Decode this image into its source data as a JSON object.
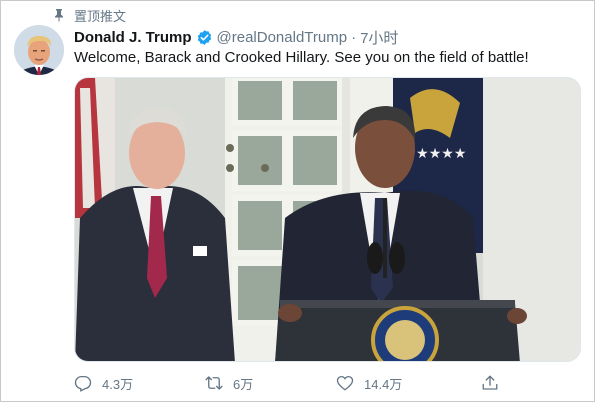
{
  "pinned_label": "置顶推文",
  "author": {
    "name": "Donald J. Trump",
    "handle": "@realDonaldTrump",
    "separator": "·",
    "time": "7小时"
  },
  "tweet": {
    "text": "Welcome, Barack and Crooked Hillary. See you on the field of battle!"
  },
  "actions": {
    "reply_count": "4.3万",
    "retweet_count": "6万",
    "like_count": "14.4万"
  },
  "icons": {
    "pinned": "pin-icon",
    "verified": "verified-badge-icon",
    "reply": "reply-icon",
    "retweet": "retweet-icon",
    "like": "heart-icon",
    "share": "share-icon"
  },
  "colors": {
    "verified_blue": "#1da1f2",
    "secondary_text": "#657786",
    "primary_text": "#14171a"
  }
}
